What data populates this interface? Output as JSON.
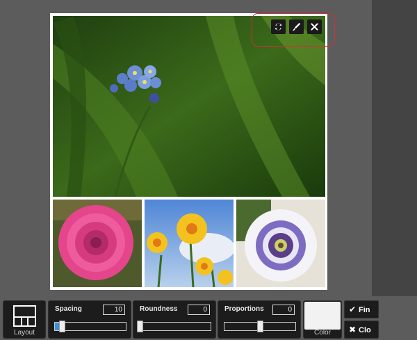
{
  "photo_toolbar": {
    "swap_icon": "swap-icon",
    "edit_icon": "brush-icon",
    "remove_icon": "close-icon",
    "highlight_color": "#cc3333"
  },
  "collage": {
    "border_color": "#ffffff",
    "photos": [
      {
        "subject": "forget-me-not flower",
        "icon": "photo-forget-me-not"
      },
      {
        "subject": "pink dahlia",
        "icon": "photo-dahlia"
      },
      {
        "subject": "daffodils",
        "icon": "photo-daffodils"
      },
      {
        "subject": "passion flower",
        "icon": "photo-passion-flower"
      }
    ]
  },
  "controls": {
    "layout": {
      "caption": "Layout",
      "icon": "layout-grid-icon"
    },
    "spacing": {
      "label": "Spacing",
      "value": "10",
      "fraction": 0.1
    },
    "roundness": {
      "label": "Roundness",
      "value": "0",
      "fraction": 0.0
    },
    "proportions": {
      "label": "Proportions",
      "value": "0",
      "fraction": 0.5
    },
    "color": {
      "caption": "Color",
      "swatch": "#f2f2f2"
    },
    "finish": {
      "label": "Fin",
      "icon": "check-icon"
    },
    "close": {
      "label": "Clo",
      "icon": "close-icon"
    }
  },
  "accent_color": "#3d8fd8"
}
